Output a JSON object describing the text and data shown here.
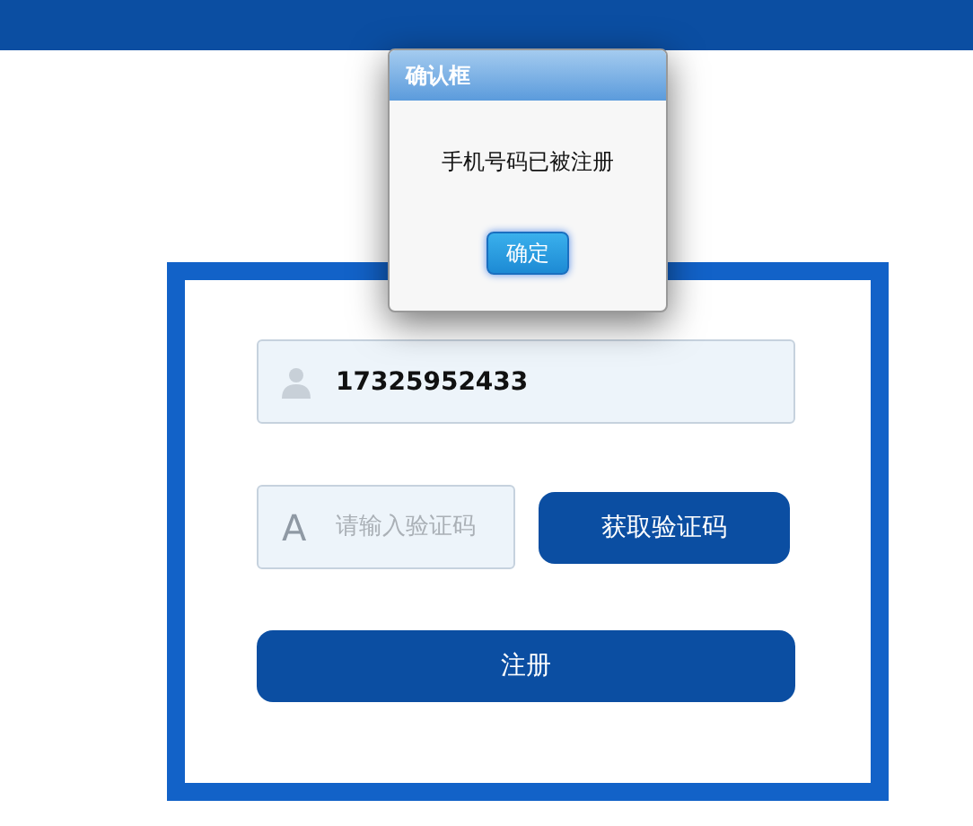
{
  "dialog": {
    "title": "确认框",
    "message": "手机号码已被注册",
    "button": "确定"
  },
  "form": {
    "phone": {
      "value": "17325952433"
    },
    "code": {
      "icon_char": "A",
      "placeholder": "请输入验证码"
    },
    "get_code_button": "获取验证码",
    "register_button": "注册"
  }
}
